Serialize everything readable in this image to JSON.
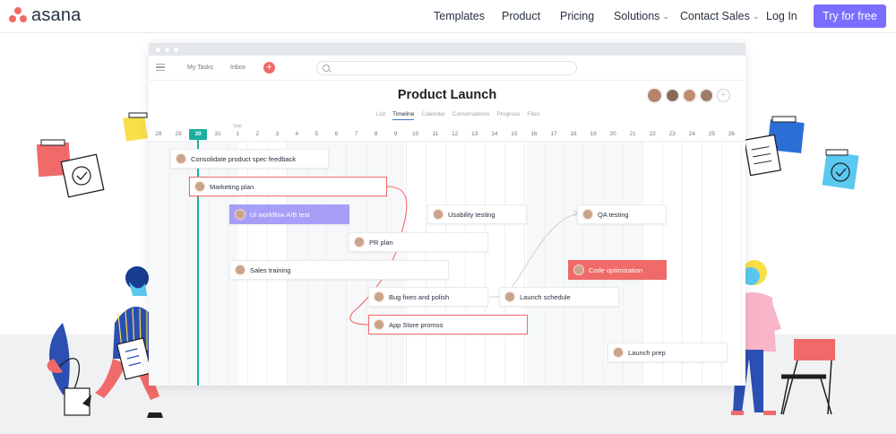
{
  "nav": {
    "logo_text": "asana",
    "logo_color": "#f06a6a",
    "items": [
      {
        "label": "Templates",
        "dropdown": false
      },
      {
        "label": "Product",
        "dropdown": false
      },
      {
        "label": "Pricing",
        "dropdown": false
      },
      {
        "label": "Solutions",
        "dropdown": true
      },
      {
        "label": "Contact Sales",
        "dropdown": true
      },
      {
        "label": "Log In",
        "dropdown": false
      }
    ],
    "cta_label": "Try for free",
    "cta_color": "#796eff"
  },
  "app": {
    "top_links": [
      "My Tasks",
      "Inbox"
    ],
    "project_title": "Product Launch",
    "tabs": [
      "List",
      "Timeline",
      "Calendar",
      "Conversations",
      "Progress",
      "Files"
    ],
    "active_tab": "Timeline",
    "month_label": "Sep",
    "dates": [
      "28",
      "29",
      "30",
      "31",
      "1",
      "2",
      "3",
      "4",
      "5",
      "6",
      "7",
      "8",
      "9",
      "10",
      "11",
      "12",
      "13",
      "14",
      "15",
      "16",
      "17",
      "18",
      "19",
      "20",
      "21",
      "22",
      "23",
      "24",
      "25",
      "26"
    ],
    "today": "30",
    "tasks": [
      {
        "label": "Consolidate product spec feedback",
        "style": "normal"
      },
      {
        "label": "Marketing plan",
        "style": "selected"
      },
      {
        "label": "UI workflow A/B test",
        "style": "purple"
      },
      {
        "label": "Usability testing",
        "style": "normal"
      },
      {
        "label": "QA testing",
        "style": "normal"
      },
      {
        "label": "PR plan",
        "style": "normal"
      },
      {
        "label": "Sales training",
        "style": "normal"
      },
      {
        "label": "Code optimization",
        "style": "red"
      },
      {
        "label": "Bug fixes and polish",
        "style": "normal"
      },
      {
        "label": "Launch schedule",
        "style": "normal"
      },
      {
        "label": "App Store promos",
        "style": "selected"
      },
      {
        "label": "Launch prep",
        "style": "normal"
      }
    ]
  }
}
